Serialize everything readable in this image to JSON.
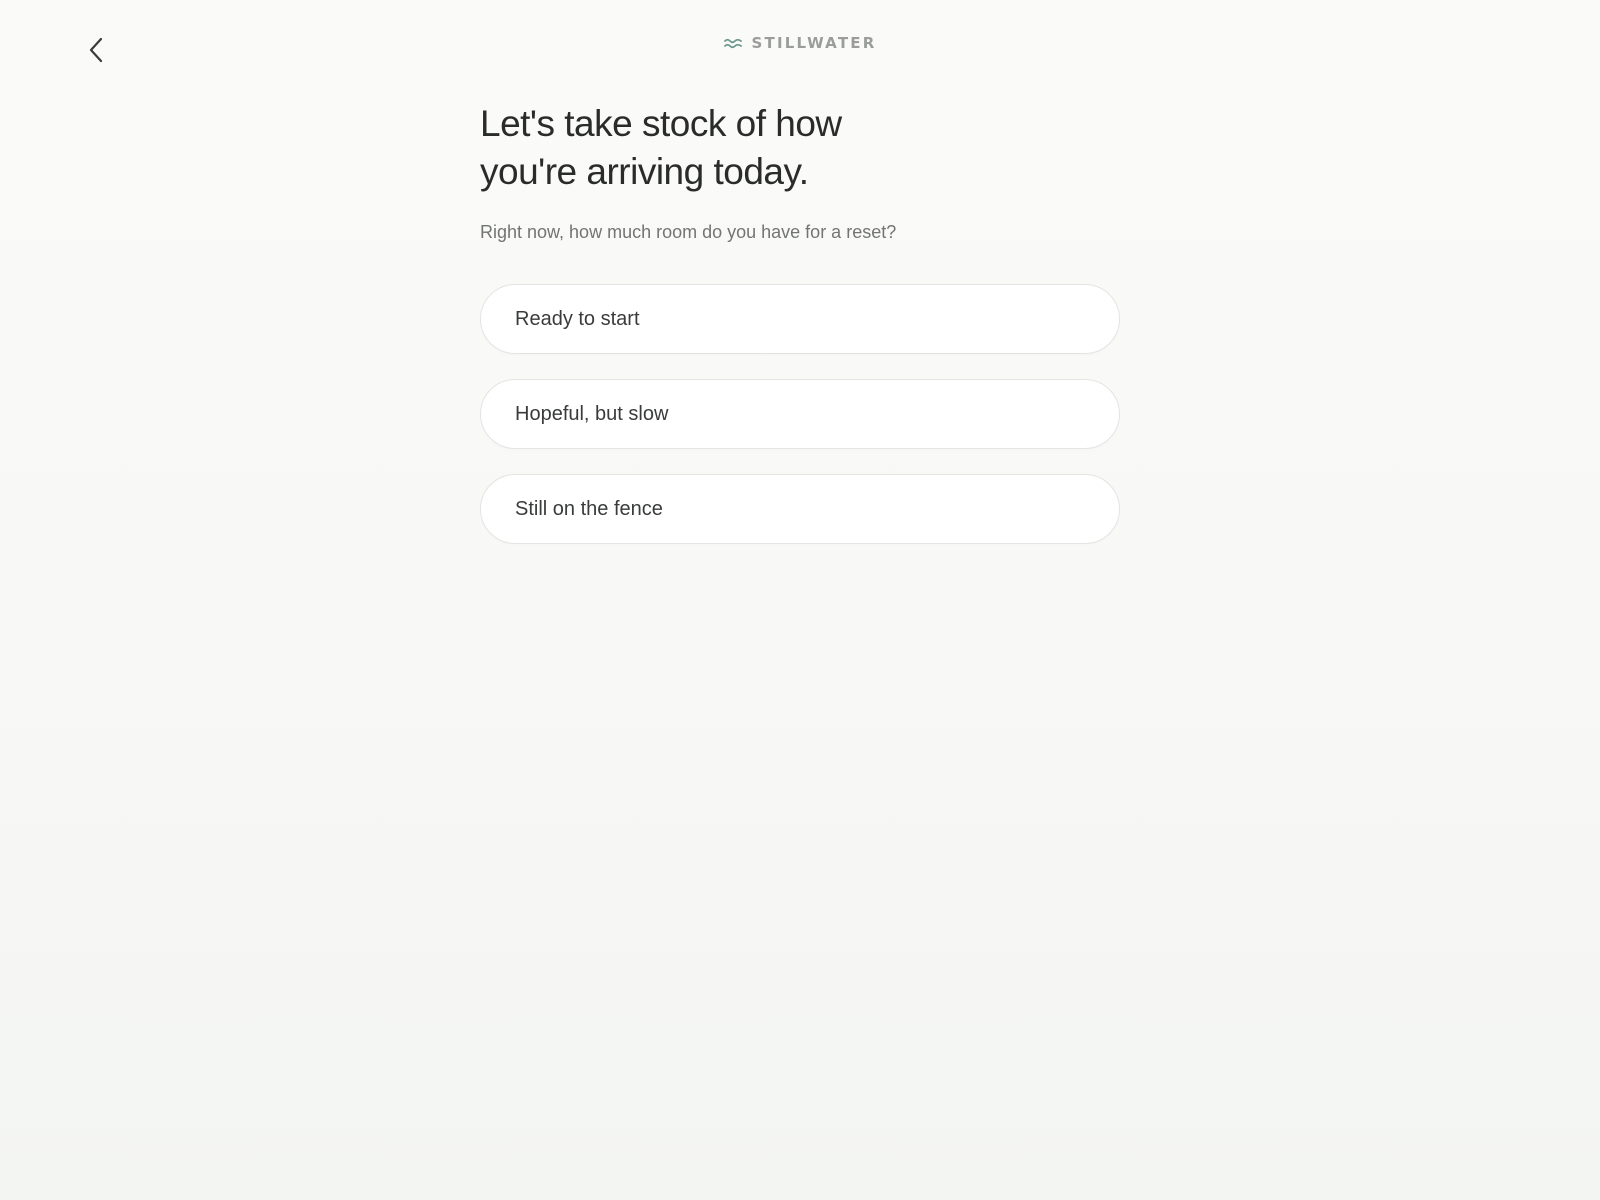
{
  "nav": {
    "back_icon": "chevron-left-icon"
  },
  "brand": {
    "logo_icon": "waves-icon",
    "name": "STILLWATER",
    "accent_color": "#6f9a8f"
  },
  "heading": {
    "title": "Let's take stock of how you're arriving today.",
    "subtitle": "Right now, how much room do you have for a reset?"
  },
  "options": [
    {
      "label": "Ready to start"
    },
    {
      "label": "Hopeful, but slow"
    },
    {
      "label": "Still on the fence"
    }
  ]
}
